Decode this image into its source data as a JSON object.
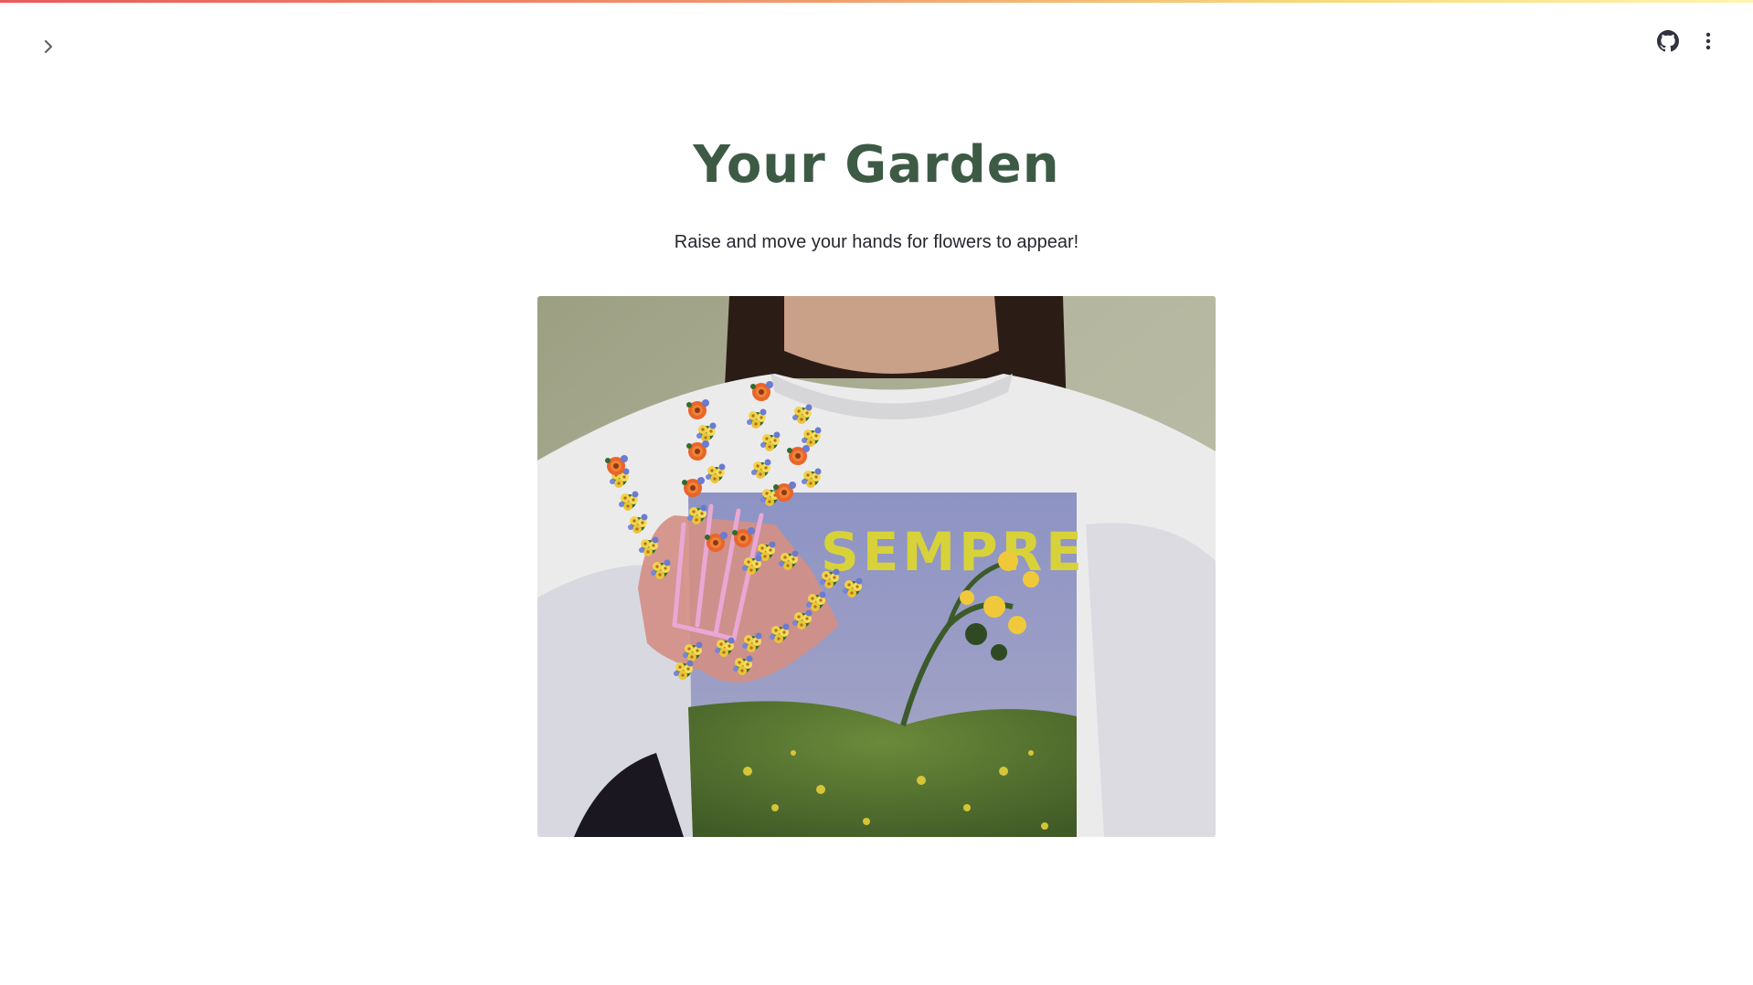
{
  "header": {
    "sidebar_toggle_icon": "chevron-right-icon",
    "github_icon": "github-icon",
    "menu_icon": "vertical-dots-icon"
  },
  "main": {
    "title": "Your Garden",
    "subtitle": "Raise and move your hands for flowers to appear!",
    "title_color": "#3d5a45"
  },
  "video": {
    "shirt_text": "SEMPRE"
  },
  "colors": {
    "accent_stripe_start": "#ea5a5a",
    "accent_stripe_end": "#fff5b0",
    "text": "#262730",
    "icon": "#31333f"
  }
}
